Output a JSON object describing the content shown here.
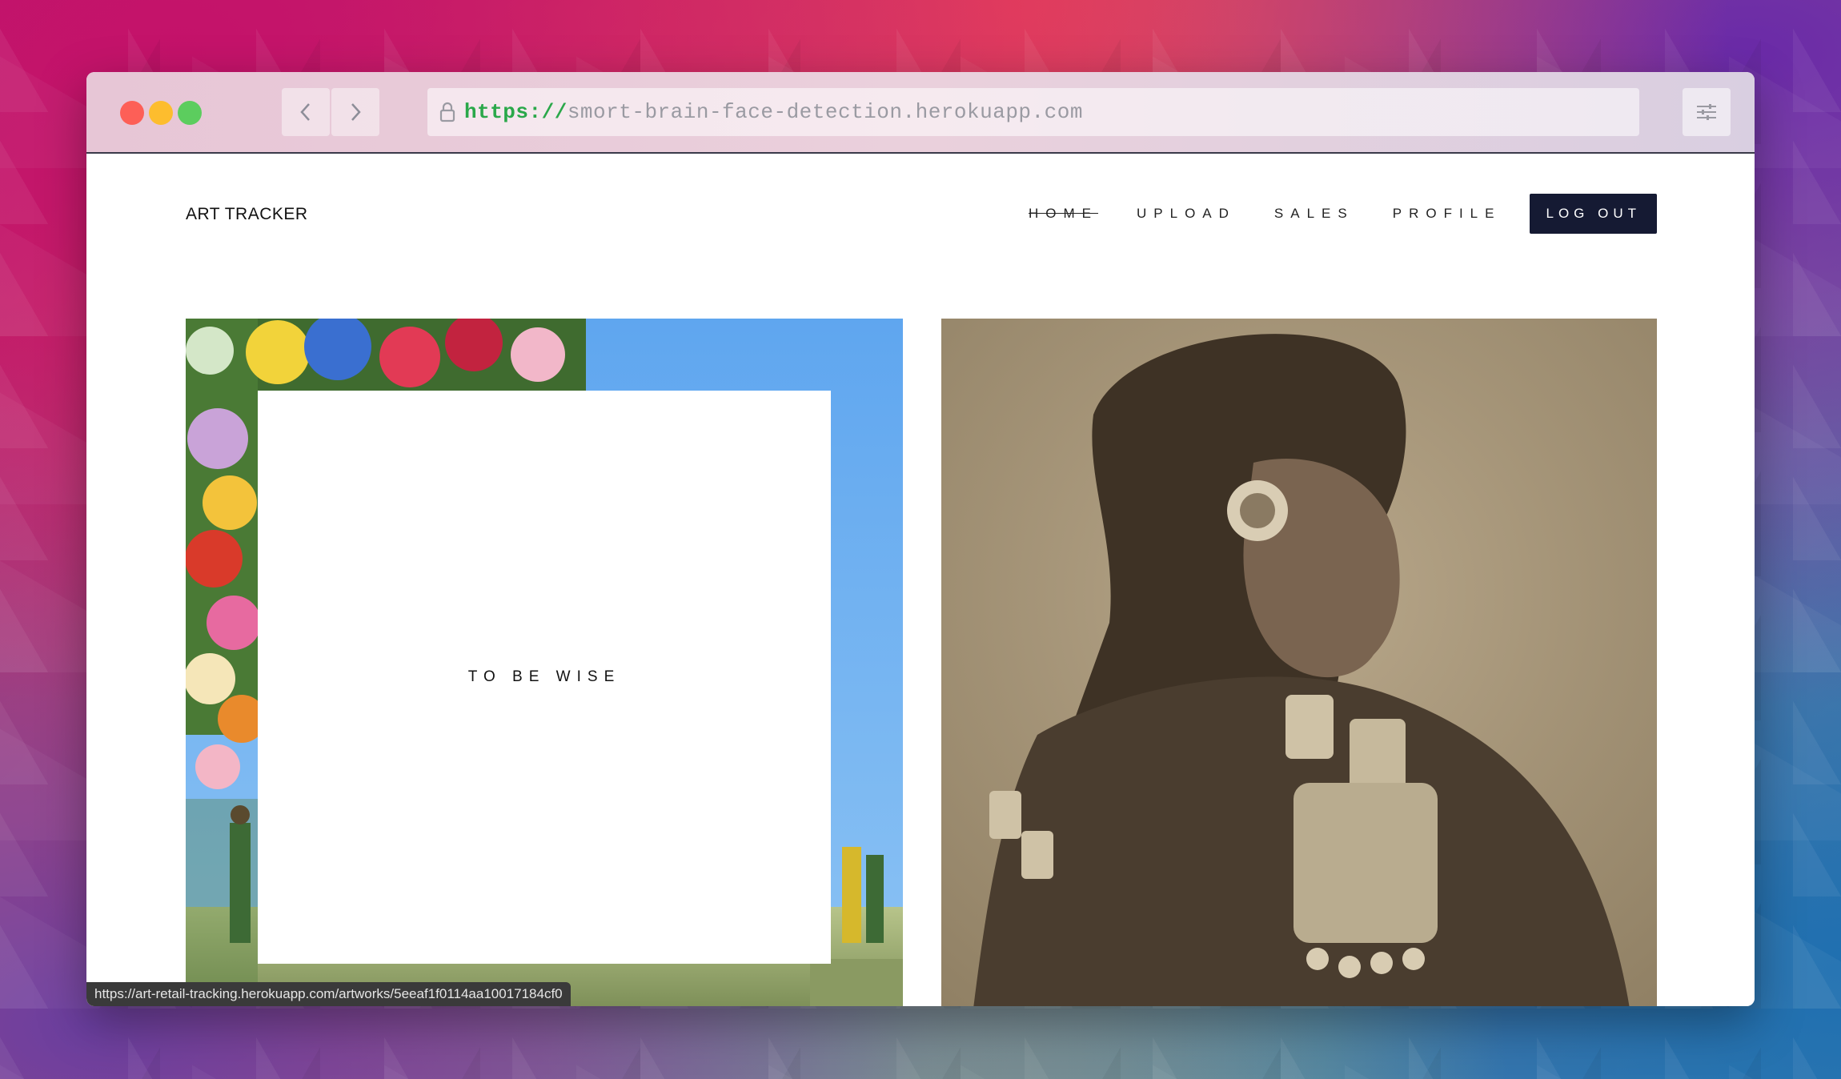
{
  "browser": {
    "url_scheme": "https://",
    "url_host": "smort-brain-face-detection.herokuapp.com",
    "status_url": "https://art-retail-tracking.herokuapp.com/artworks/5eeaf1f0114aa10017184cf0"
  },
  "site": {
    "brand": "ART TRACKER",
    "nav": {
      "home": "HOME",
      "upload": "UPLOAD",
      "sales": "SALES",
      "profile": "PROFILE",
      "logout": "LOG OUT"
    }
  },
  "artworks": [
    {
      "overlay_title": "TO BE WISE"
    },
    {
      "overlay_title": ""
    }
  ],
  "colors": {
    "logout_bg": "#151a33",
    "url_scheme": "#2aa84a"
  },
  "icons": [
    "lock-icon",
    "chevron-left-icon",
    "chevron-right-icon",
    "sliders-icon"
  ]
}
